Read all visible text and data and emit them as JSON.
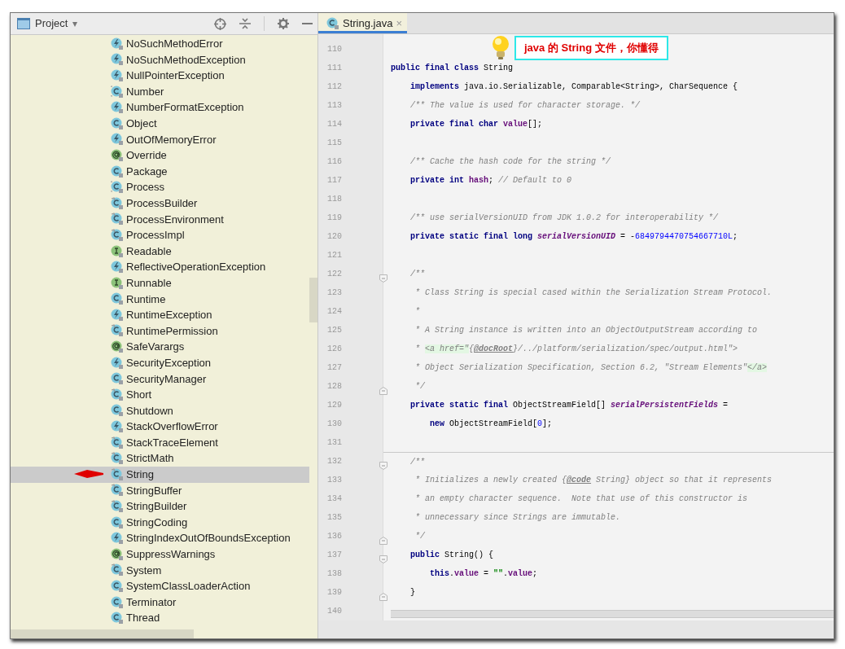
{
  "project_panel": {
    "title": "Project",
    "dropdown": "▾"
  },
  "tree": {
    "items": [
      {
        "label": "NoSuchMethodError",
        "kind": "exception",
        "selected": false
      },
      {
        "label": "NoSuchMethodException",
        "kind": "exception",
        "selected": false
      },
      {
        "label": "NullPointerException",
        "kind": "exception",
        "selected": false
      },
      {
        "label": "Number",
        "kind": "abstract_class",
        "selected": false
      },
      {
        "label": "NumberFormatException",
        "kind": "exception",
        "selected": false
      },
      {
        "label": "Object",
        "kind": "class",
        "selected": false
      },
      {
        "label": "OutOfMemoryError",
        "kind": "exception",
        "selected": false
      },
      {
        "label": "Override",
        "kind": "annotation",
        "selected": false
      },
      {
        "label": "Package",
        "kind": "class",
        "selected": false
      },
      {
        "label": "Process",
        "kind": "abstract_class",
        "selected": false
      },
      {
        "label": "ProcessBuilder",
        "kind": "final_class",
        "selected": false
      },
      {
        "label": "ProcessEnvironment",
        "kind": "final_class",
        "selected": false
      },
      {
        "label": "ProcessImpl",
        "kind": "final_class",
        "selected": false
      },
      {
        "label": "Readable",
        "kind": "interface",
        "selected": false
      },
      {
        "label": "ReflectiveOperationException",
        "kind": "exception",
        "selected": false
      },
      {
        "label": "Runnable",
        "kind": "interface",
        "selected": false
      },
      {
        "label": "Runtime",
        "kind": "class",
        "selected": false
      },
      {
        "label": "RuntimeException",
        "kind": "exception",
        "selected": false
      },
      {
        "label": "RuntimePermission",
        "kind": "final_class",
        "selected": false
      },
      {
        "label": "SafeVarargs",
        "kind": "annotation",
        "selected": false
      },
      {
        "label": "SecurityException",
        "kind": "exception",
        "selected": false
      },
      {
        "label": "SecurityManager",
        "kind": "class",
        "selected": false
      },
      {
        "label": "Short",
        "kind": "final_class",
        "selected": false
      },
      {
        "label": "Shutdown",
        "kind": "class",
        "selected": false
      },
      {
        "label": "StackOverflowError",
        "kind": "exception",
        "selected": false
      },
      {
        "label": "StackTraceElement",
        "kind": "final_class",
        "selected": false
      },
      {
        "label": "StrictMath",
        "kind": "final_class",
        "selected": false
      },
      {
        "label": "String",
        "kind": "final_class",
        "selected": true
      },
      {
        "label": "StringBuffer",
        "kind": "final_class",
        "selected": false
      },
      {
        "label": "StringBuilder",
        "kind": "final_class",
        "selected": false
      },
      {
        "label": "StringCoding",
        "kind": "class",
        "selected": false
      },
      {
        "label": "StringIndexOutOfBoundsException",
        "kind": "exception",
        "selected": false
      },
      {
        "label": "SuppressWarnings",
        "kind": "annotation",
        "selected": false
      },
      {
        "label": "System",
        "kind": "final_class",
        "selected": false
      },
      {
        "label": "SystemClassLoaderAction",
        "kind": "class",
        "selected": false
      },
      {
        "label": "Terminator",
        "kind": "class",
        "selected": false
      },
      {
        "label": "Thread",
        "kind": "class",
        "selected": false
      }
    ]
  },
  "editor": {
    "tabs": [
      {
        "label": "String.java",
        "close": "×",
        "selected": true
      }
    ],
    "annotation": {
      "text": "java 的 String 文件，你懂得"
    },
    "lines": [
      {
        "number": "110"
      },
      {
        "number": "111",
        "tokens": [
          {
            "kind": "kw",
            "text": "public final class"
          },
          {
            "kind": "text",
            "text": " String"
          }
        ]
      },
      {
        "number": "112",
        "tokens": [
          {
            "kind": "kw",
            "text": "    implements"
          },
          {
            "kind": "text",
            "text": " java.io.Serializable, Comparable<String>, CharSequence {"
          }
        ]
      },
      {
        "number": "113",
        "tokens": [
          {
            "kind": "comment",
            "text": "    /** The value is used for character storage. */"
          }
        ]
      },
      {
        "number": "114",
        "tokens": [
          {
            "kind": "kw",
            "text": "    private final char "
          },
          {
            "kind": "member",
            "text": "value"
          },
          {
            "kind": "text",
            "text": "[];"
          }
        ]
      },
      {
        "number": "115"
      },
      {
        "number": "116",
        "tokens": [
          {
            "kind": "comment",
            "text": "    /** Cache the hash code for the string */"
          }
        ]
      },
      {
        "number": "117",
        "tokens": [
          {
            "kind": "kw",
            "text": "    private int "
          },
          {
            "kind": "member",
            "text": "hash"
          },
          {
            "kind": "text",
            "text": "; "
          },
          {
            "kind": "comment",
            "text": "// Default to 0"
          }
        ]
      },
      {
        "number": "118"
      },
      {
        "number": "119",
        "tokens": [
          {
            "kind": "comment",
            "text": "    /** use serialVersionUID from JDK 1.0.2 for interoperability */"
          }
        ]
      },
      {
        "number": "120",
        "tokens": [
          {
            "kind": "kw",
            "text": "    private static final long "
          },
          {
            "kind": "field",
            "text": "serialVersionUID"
          },
          {
            "kind": "text",
            "text": " = -"
          },
          {
            "kind": "number",
            "text": "6849794470754667710L"
          },
          {
            "kind": "text",
            "text": ";"
          }
        ]
      },
      {
        "number": "121"
      },
      {
        "number": "122",
        "fold_open": true,
        "tokens": [
          {
            "kind": "comment",
            "text": "    /**"
          }
        ]
      },
      {
        "number": "123",
        "tokens": [
          {
            "kind": "comment",
            "text": "     * Class String is special cased within the Serialization Stream Protocol."
          }
        ]
      },
      {
        "number": "124",
        "tokens": [
          {
            "kind": "comment",
            "text": "     *"
          }
        ]
      },
      {
        "number": "125",
        "tokens": [
          {
            "kind": "comment",
            "text": "     * A String instance is written into an ObjectOutputStream according to"
          }
        ]
      },
      {
        "number": "126",
        "tokens": [
          {
            "kind": "comment",
            "text": "     * "
          },
          {
            "kind": "markup",
            "text": "<a href=\""
          },
          {
            "kind": "comment",
            "text": "{"
          },
          {
            "kind": "doctag",
            "text": "@docRoot"
          },
          {
            "kind": "comment",
            "text": "}/../platform/serialization/spec/output.html\">"
          }
        ]
      },
      {
        "number": "127",
        "tokens": [
          {
            "kind": "comment",
            "text": "     * Object Serialization Specification, Section 6.2, \"Stream Elements\""
          },
          {
            "kind": "markup",
            "text": "</a>"
          }
        ]
      },
      {
        "number": "128",
        "fold_close": true,
        "tokens": [
          {
            "kind": "comment",
            "text": "     */"
          }
        ]
      },
      {
        "number": "129",
        "tokens": [
          {
            "kind": "kw",
            "text": "    private static final"
          },
          {
            "kind": "text",
            "text": " ObjectStreamField[] "
          },
          {
            "kind": "field",
            "text": "serialPersistentFields"
          },
          {
            "kind": "text",
            "text": " ="
          }
        ]
      },
      {
        "number": "130",
        "tokens": [
          {
            "kind": "kw",
            "text": "        new"
          },
          {
            "kind": "text",
            "text": " ObjectStreamField["
          },
          {
            "kind": "number",
            "text": "0"
          },
          {
            "kind": "text",
            "text": "];"
          }
        ]
      },
      {
        "number": "131"
      },
      {
        "number": "132",
        "fold_open": true,
        "separator": true,
        "tokens": [
          {
            "kind": "comment",
            "text": "    /**"
          }
        ]
      },
      {
        "number": "133",
        "tokens": [
          {
            "kind": "comment",
            "text": "     * Initializes a newly created {"
          },
          {
            "kind": "doctag",
            "text": "@code"
          },
          {
            "kind": "comment",
            "text": " String} object so that it represents"
          }
        ]
      },
      {
        "number": "134",
        "tokens": [
          {
            "kind": "comment",
            "text": "     * an empty character sequence.  Note that use of this constructor is"
          }
        ]
      },
      {
        "number": "135",
        "tokens": [
          {
            "kind": "comment",
            "text": "     * unnecessary since Strings are immutable."
          }
        ]
      },
      {
        "number": "136",
        "fold_close": true,
        "tokens": [
          {
            "kind": "comment",
            "text": "     */"
          }
        ]
      },
      {
        "number": "137",
        "fold_open": true,
        "tokens": [
          {
            "kind": "kw",
            "text": "    public"
          },
          {
            "kind": "text",
            "text": " String() {"
          }
        ]
      },
      {
        "number": "138",
        "tokens": [
          {
            "kind": "kw",
            "text": "        this"
          },
          {
            "kind": "text",
            "text": "."
          },
          {
            "kind": "member",
            "text": "value"
          },
          {
            "kind": "text",
            "text": " = "
          },
          {
            "kind": "string",
            "text": "\"\""
          },
          {
            "kind": "text",
            "text": "."
          },
          {
            "kind": "member",
            "text": "value"
          },
          {
            "kind": "text",
            "text": ";"
          }
        ]
      },
      {
        "number": "139",
        "fold_close": true,
        "tokens": [
          {
            "kind": "text",
            "text": "    }"
          }
        ]
      },
      {
        "number": "140"
      }
    ]
  }
}
